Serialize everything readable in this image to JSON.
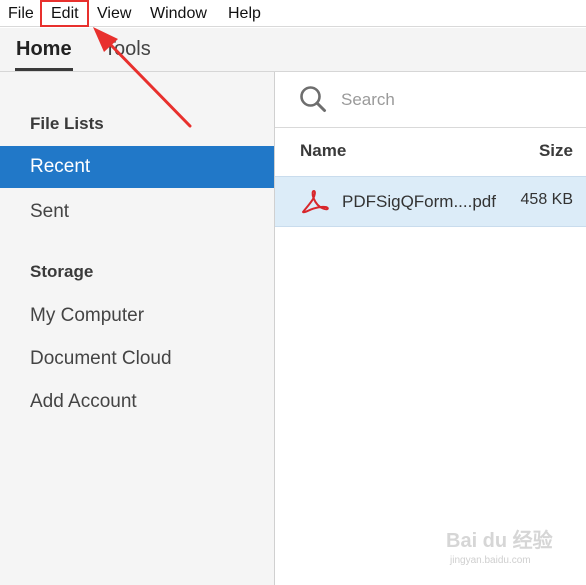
{
  "menubar": {
    "items": [
      "File",
      "Edit",
      "View",
      "Window",
      "Help"
    ]
  },
  "tabs": [
    {
      "label": "Home",
      "active": true
    },
    {
      "label": "Tools",
      "active": false
    }
  ],
  "sidebar": {
    "sections": [
      {
        "heading": "File Lists",
        "items": [
          {
            "label": "Recent",
            "active": true
          },
          {
            "label": "Sent",
            "active": false
          }
        ]
      },
      {
        "heading": "Storage",
        "items": [
          {
            "label": "My Computer"
          },
          {
            "label": "Document Cloud"
          },
          {
            "label": "Add Account"
          }
        ]
      }
    ]
  },
  "main": {
    "search": {
      "placeholder": "Search"
    },
    "columns": {
      "name": "Name",
      "size": "Size"
    },
    "files": [
      {
        "icon": "pdf-icon",
        "name": "PDFSigQForm....pdf",
        "size": "458 KB"
      }
    ]
  },
  "annotation": {
    "color": "#e8302d",
    "target": "Edit"
  },
  "watermark": {
    "text": "Bai du 经验",
    "subtext": "jingyan.baidu.com"
  },
  "colors": {
    "accent": "#2178c8",
    "selected_row": "#dcecf8",
    "pdf_red": "#d8262b"
  }
}
